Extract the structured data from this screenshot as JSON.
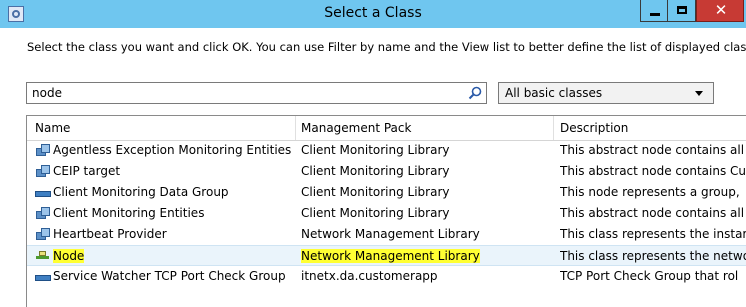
{
  "window": {
    "title": "Select a Class",
    "close_glyph": "✕"
  },
  "instructions": "Select the class you want and click OK. You can use Filter by name and the View list to better define the list of displayed classes.",
  "filter": {
    "value": "node"
  },
  "view": {
    "selected": "All basic classes"
  },
  "columns": {
    "name": "Name",
    "management_pack": "Management Pack",
    "description": "Description"
  },
  "rows": [
    {
      "name": "Agentless Exception Monitoring Entities",
      "management_pack": "Client Monitoring Library",
      "description": "This abstract node contains all",
      "icon": "entity-icon"
    },
    {
      "name": "CEIP target",
      "management_pack": "Client Monitoring Library",
      "description": "This abstract node contains Cu",
      "icon": "entity-icon"
    },
    {
      "name": "Client Monitoring Data Group",
      "management_pack": "Client Monitoring Library",
      "description": "This node represents a group,",
      "icon": "group-icon"
    },
    {
      "name": "Client Monitoring Entities",
      "management_pack": "Client Monitoring Library",
      "description": "This abstract node contains all",
      "icon": "entity-icon"
    },
    {
      "name": "Heartbeat Provider",
      "management_pack": "Network Management Library",
      "description": "This class represents the instar",
      "icon": "entity-icon"
    },
    {
      "name": "Node",
      "management_pack": "Network Management Library",
      "description": "This class represents the netwo",
      "icon": "node-icon"
    },
    {
      "name": "Service Watcher TCP Port Check Group",
      "management_pack": "itnetx.da.customerapp",
      "description": "TCP Port Check Group that rol",
      "icon": "group-icon"
    }
  ],
  "colors": {
    "titlebar": "#6fc6ef",
    "highlight": "#ffff33",
    "selected_row": "#eaf4fb",
    "close_button": "#c73a34"
  }
}
